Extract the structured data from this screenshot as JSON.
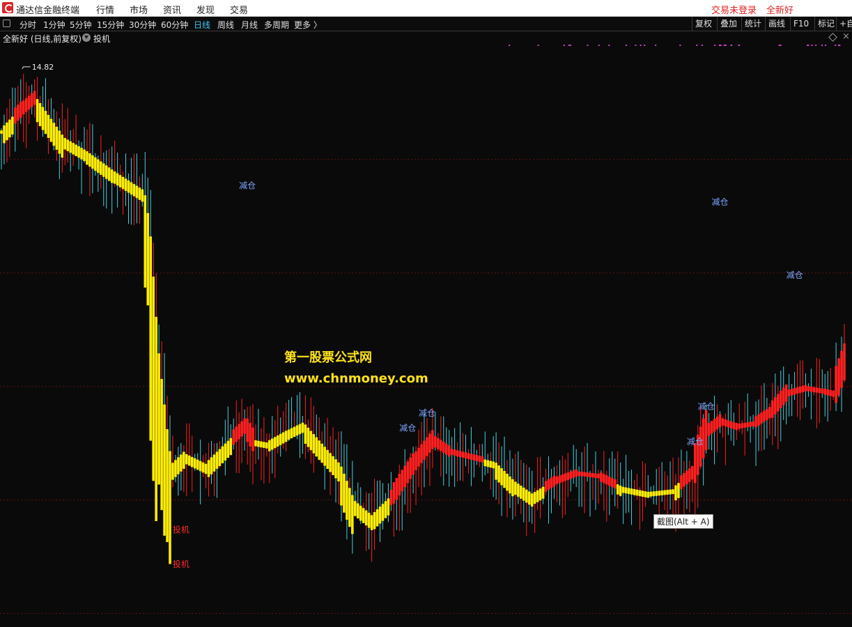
{
  "app": {
    "title": "通达信金融终端",
    "menu": [
      "行情",
      "市场",
      "资讯",
      "发现",
      "交易"
    ],
    "login_status": "交易未登录",
    "stock_short": "全新好"
  },
  "toolbar": {
    "periods": [
      "分时",
      "1分钟",
      "5分钟",
      "15分钟",
      "30分钟",
      "60分钟",
      "日线",
      "周线",
      "月线",
      "多周期",
      "更多 〉"
    ],
    "active_period": "日线",
    "buttons": [
      "复权",
      "叠加",
      "统计",
      "画线",
      "F10",
      "标记",
      "+自"
    ]
  },
  "info": {
    "stock_label": "全新好 (日线,前复权)",
    "indicator": "投机"
  },
  "watermark": {
    "line1": "第一股票公式网",
    "line2": "www.chnmoney.com"
  },
  "tooltip": "截图(Alt + A)",
  "colors": {
    "background": "#0a0a0a",
    "up": "#ff2020",
    "down_band": "#ffee00",
    "wick": "#45d2e0",
    "signal_sell": "#7ea6ff",
    "signal_buy": "#ff2a2a",
    "accent": "#3ec8f2",
    "grid": "#6a1010",
    "dots": "#d040d0"
  },
  "chart_data": {
    "type": "candlestick-indicator",
    "y_units": "price",
    "ylim": [
      4.6,
      15.2
    ],
    "max_price_label": "14.82",
    "max_price": 14.82,
    "signals": [
      {
        "text": "减仓",
        "type": "sell",
        "bar": 87,
        "price": 12.6
      },
      {
        "text": "减仓",
        "type": "sell",
        "bar": 145,
        "price": 8.18
      },
      {
        "text": "减仓",
        "type": "sell",
        "bar": 152,
        "price": 8.45
      },
      {
        "text": "减仓",
        "type": "sell",
        "bar": 249,
        "price": 7.93
      },
      {
        "text": "减仓",
        "type": "sell",
        "bar": 253,
        "price": 8.57
      },
      {
        "text": "减仓",
        "type": "sell",
        "bar": 258,
        "price": 12.3
      },
      {
        "text": "减仓",
        "type": "sell",
        "bar": 285,
        "price": 10.97
      },
      {
        "text": "投机",
        "type": "buy",
        "bar": 63,
        "price": 6.32
      },
      {
        "text": "投机",
        "type": "buy",
        "bar": 63,
        "price": 5.69
      }
    ],
    "band_points": [
      [
        0,
        13.65
      ],
      [
        7,
        14.02
      ],
      [
        12,
        14.24
      ],
      [
        22,
        13.52
      ],
      [
        30,
        13.28
      ],
      [
        40,
        12.91
      ],
      [
        51,
        12.55
      ],
      [
        53,
        11.9
      ],
      [
        56,
        9.7
      ],
      [
        59,
        8.3
      ],
      [
        61,
        7.5
      ],
      [
        66,
        7.75
      ],
      [
        74,
        7.55
      ],
      [
        80,
        7.85
      ],
      [
        86,
        8.15
      ],
      [
        88,
        8.25
      ],
      [
        91,
        8.0
      ],
      [
        96,
        7.95
      ],
      [
        103,
        8.15
      ],
      [
        109,
        8.3
      ],
      [
        115,
        7.95
      ],
      [
        122,
        7.55
      ],
      [
        127,
        6.9
      ],
      [
        134,
        6.6
      ],
      [
        141,
        6.95
      ],
      [
        149,
        7.55
      ],
      [
        156,
        8.0
      ],
      [
        162,
        7.8
      ],
      [
        170,
        7.7
      ],
      [
        178,
        7.6
      ],
      [
        185,
        7.25
      ],
      [
        192,
        7.0
      ],
      [
        200,
        7.25
      ],
      [
        208,
        7.4
      ],
      [
        216,
        7.35
      ],
      [
        224,
        7.15
      ],
      [
        234,
        7.05
      ],
      [
        243,
        7.1
      ],
      [
        250,
        7.4
      ],
      [
        255,
        8.15
      ],
      [
        260,
        8.35
      ],
      [
        266,
        8.25
      ],
      [
        272,
        8.3
      ],
      [
        278,
        8.5
      ],
      [
        284,
        8.85
      ],
      [
        291,
        8.95
      ],
      [
        297,
        8.9
      ],
      [
        301,
        8.85
      ],
      [
        305,
        9.4
      ],
      [
        306,
        9.3
      ]
    ],
    "red_ranges": [
      [
        5,
        12
      ],
      [
        84,
        91
      ],
      [
        141,
        174
      ],
      [
        197,
        222
      ],
      [
        246,
        306
      ]
    ],
    "n_bars": 306
  }
}
